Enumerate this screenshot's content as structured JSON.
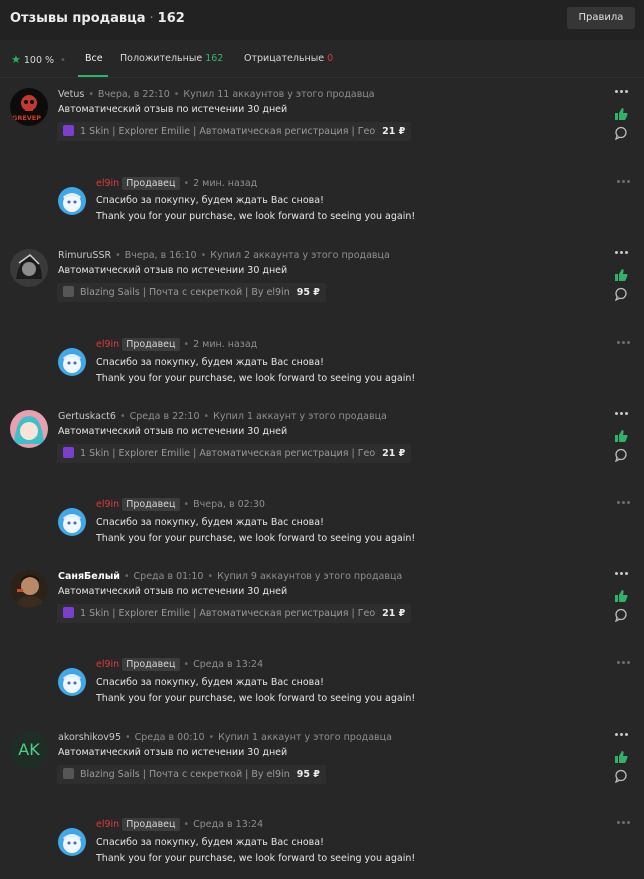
{
  "header": {
    "title": "Отзывы продавца",
    "count": "162",
    "rules_label": "Правила"
  },
  "filters": {
    "rating": "100 %",
    "tabs": {
      "all": "Все",
      "positive": "Положительные",
      "positive_count": "162",
      "negative": "Отрицательные",
      "negative_count": "0"
    }
  },
  "reviews": [
    {
      "user": "Vetus",
      "time": "Вчера, в 22:10",
      "purchase": "Купил 11 аккаунтов у этого продавца",
      "text": "Автоматический отзыв по истечении 30 дней",
      "product": "1 Skin | Explorer Emilie | Автоматическая регистрация | Гео",
      "product_icon": "fortnite-icon",
      "price": "21 ₽",
      "avatar_label": "GREVEP",
      "reply": {
        "seller": "el9in",
        "badge": "Продавец",
        "time": "2 мин. назад",
        "line1": "Спасибо за покупку, будем ждать Вас снова!",
        "line2": "Thank you for your purchase, we look forward to seeing you again!"
      }
    },
    {
      "user": "RimuruSSR",
      "time": "Вчера, в 16:10",
      "purchase": "Купил 2 аккаунта у этого продавца",
      "text": "Автоматический отзыв по истечении 30 дней",
      "product": "Blazing Sails | Почта с секреткой | By el9in",
      "product_icon": "game-icon",
      "price": "95 ₽",
      "avatar_label": "",
      "reply": {
        "seller": "el9in",
        "badge": "Продавец",
        "time": "2 мин. назад",
        "line1": "Спасибо за покупку, будем ждать Вас снова!",
        "line2": "Thank you for your purchase, we look forward to seeing you again!"
      }
    },
    {
      "user": "Gertuskact6",
      "time": "Среда в 22:10",
      "purchase": "Купил 1 аккаунт у этого продавца",
      "text": "Автоматический отзыв по истечении 30 дней",
      "product": "1 Skin | Explorer Emilie | Автоматическая регистрация | Гео",
      "product_icon": "fortnite-icon",
      "price": "21 ₽",
      "avatar_label": "",
      "reply": {
        "seller": "el9in",
        "badge": "Продавец",
        "time": "Вчера, в 02:30",
        "line1": "Спасибо за покупку, будем ждать Вас снова!",
        "line2": "Thank you for your purchase, we look forward to seeing you again!"
      }
    },
    {
      "user": "СаняБелый",
      "time": "Среда в 01:10",
      "purchase": "Купил 9 аккаунтов у этого продавца",
      "text": "Автоматический отзыв по истечении 30 дней",
      "product": "1 Skin | Explorer Emilie | Автоматическая регистрация | Гео",
      "product_icon": "fortnite-icon",
      "price": "21 ₽",
      "avatar_label": "",
      "reply": {
        "seller": "el9in",
        "badge": "Продавец",
        "time": "Среда в 13:24",
        "line1": "Спасибо за покупку, будем ждать Вас снова!",
        "line2": "Thank you for your purchase, we look forward to seeing you again!"
      }
    },
    {
      "user": "akorshikov95",
      "time": "Среда в 00:10",
      "purchase": "Купил 1 аккаунт у этого продавца",
      "text": "Автоматический отзыв по истечении 30 дней",
      "product": "Blazing Sails | Почта с секреткой | By el9in",
      "product_icon": "game-icon",
      "price": "95 ₽",
      "avatar_label": "AK",
      "reply": {
        "seller": "el9in",
        "badge": "Продавец",
        "time": "Среда в 13:24",
        "line1": "Спасибо за покупку, будем ждать Вас снова!",
        "line2": "Thank you for your purchase, we look forward to seeing you again!"
      }
    }
  ]
}
